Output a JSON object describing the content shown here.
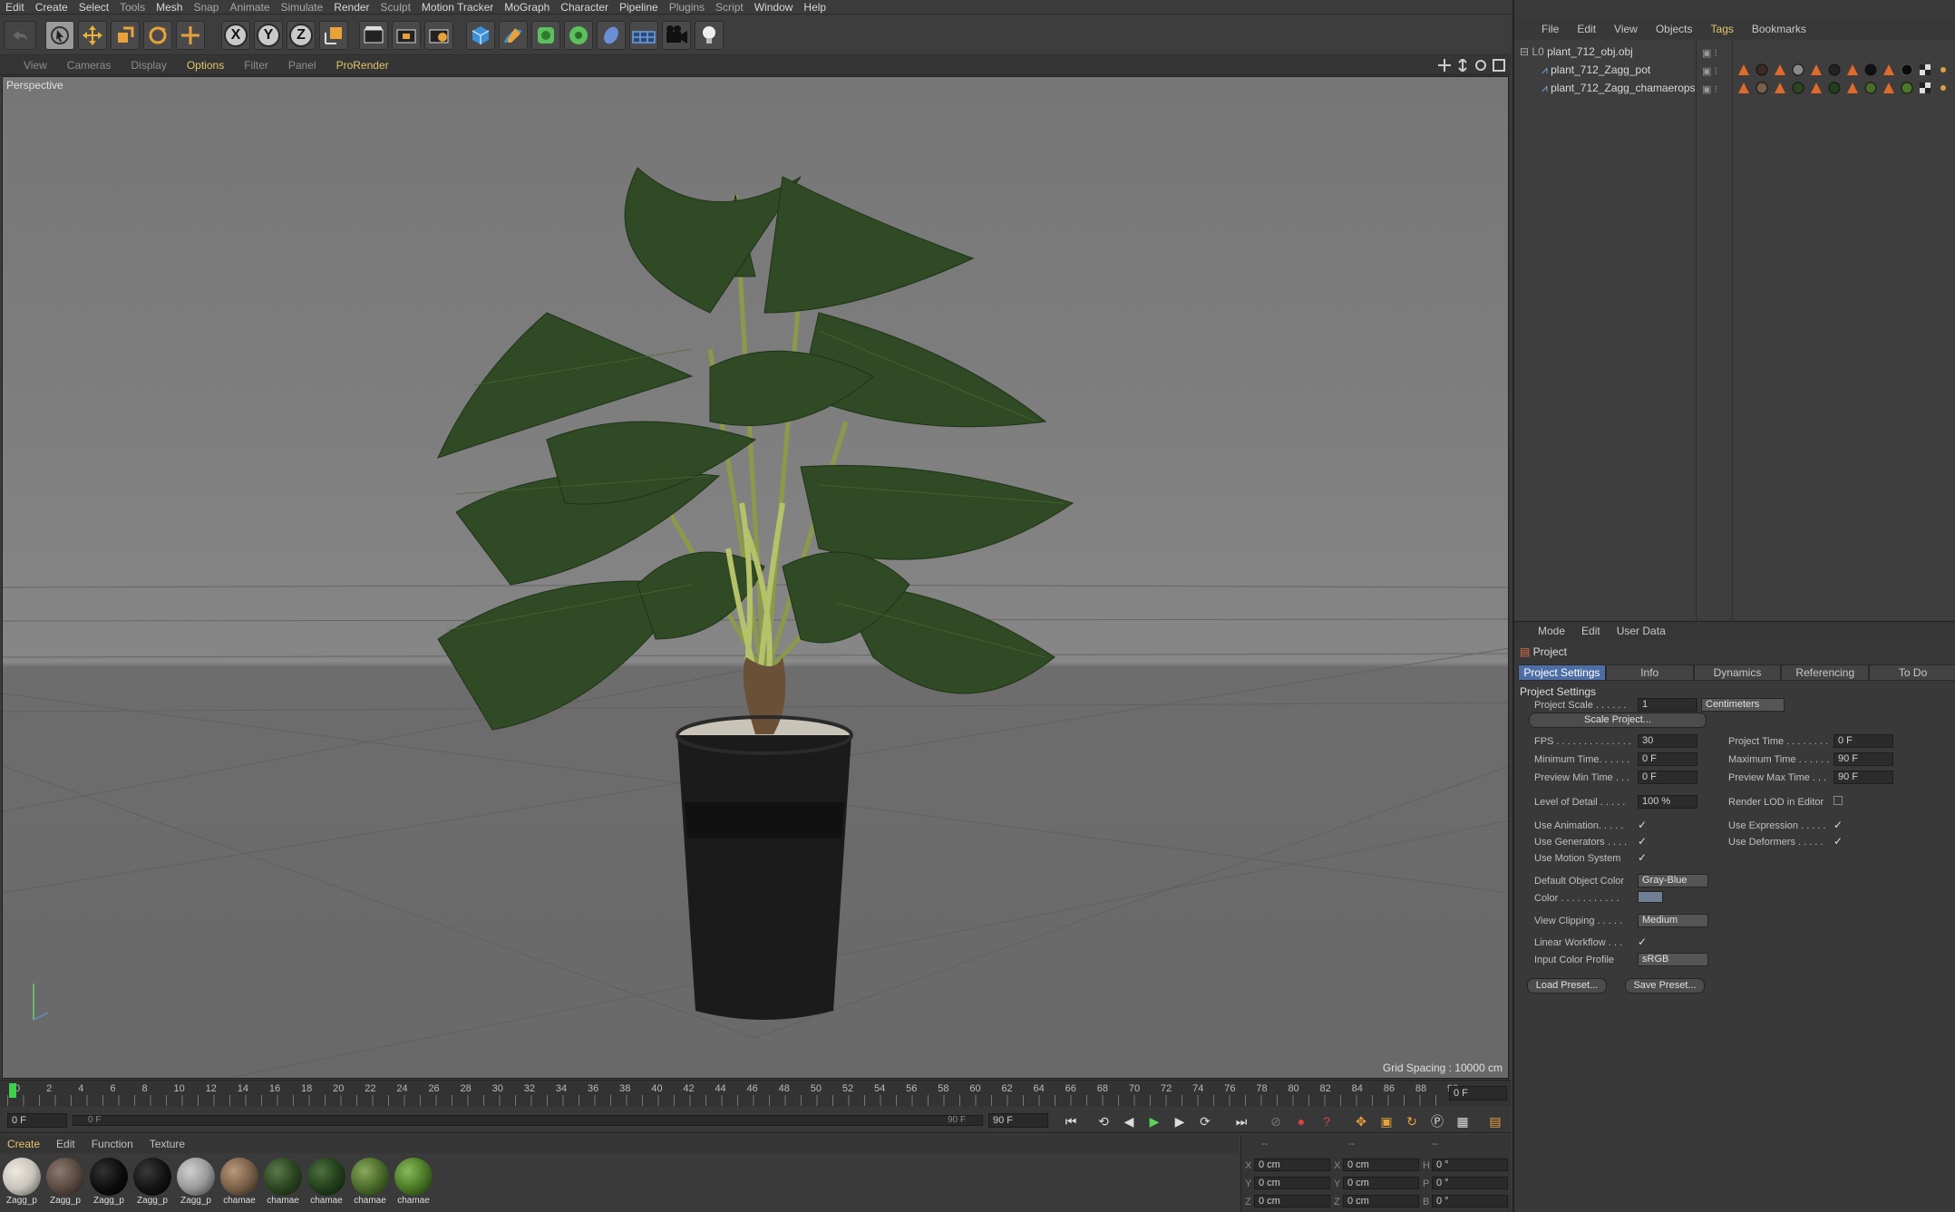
{
  "menu": [
    "Edit",
    "Create",
    "Select",
    "Tools",
    "Mesh",
    "Snap",
    "Animate",
    "Simulate",
    "Render",
    "Sculpt",
    "Motion Tracker",
    "MoGraph",
    "Character",
    "Pipeline",
    "Plugins",
    "Script",
    "Window",
    "Help"
  ],
  "toolbar": {
    "x_label": "X",
    "y_label": "Y",
    "z_label": "Z"
  },
  "viewmenu": [
    "View",
    "Cameras",
    "Display",
    "Options",
    "Filter",
    "Panel",
    "ProRender"
  ],
  "viewport": {
    "label": "Perspective",
    "grid_spacing": "Grid Spacing : 10000 cm"
  },
  "timeline": {
    "ticks": [
      "0",
      "2",
      "4",
      "6",
      "8",
      "10",
      "12",
      "14",
      "16",
      "18",
      "20",
      "22",
      "24",
      "26",
      "28",
      "30",
      "32",
      "34",
      "36",
      "38",
      "40",
      "42",
      "44",
      "46",
      "48",
      "50",
      "52",
      "54",
      "56",
      "58",
      "60",
      "62",
      "64",
      "66",
      "68",
      "70",
      "72",
      "74",
      "76",
      "78",
      "80",
      "82",
      "84",
      "86",
      "88",
      "90"
    ],
    "current_frame": "0 F",
    "start_field": "0 F",
    "range_start": "0 F",
    "range_end": "90 F",
    "end_field": "90 F"
  },
  "material_menu": [
    "Create",
    "Edit",
    "Function",
    "Texture"
  ],
  "materials": [
    {
      "label": "Zagg_p",
      "color": "#c8c4bc"
    },
    {
      "label": "Zagg_p",
      "color": "#5a4a40"
    },
    {
      "label": "Zagg_p",
      "color": "#0b0b0b"
    },
    {
      "label": "Zagg_p",
      "color": "#111111"
    },
    {
      "label": "Zagg_p",
      "color": "#9a9a9a"
    },
    {
      "label": "chamae",
      "color": "#7a6048"
    },
    {
      "label": "chamae",
      "color": "#2b4522"
    },
    {
      "label": "chamae",
      "color": "#23401c"
    },
    {
      "label": "chamae",
      "color": "#4a6a2a"
    },
    {
      "label": "chamae",
      "color": "#4a7a26"
    }
  ],
  "coordinates": {
    "header": [
      "--",
      "--",
      "--"
    ],
    "rows": [
      {
        "a": "X",
        "av": "0 cm",
        "b": "X",
        "bv": "0 cm",
        "c": "H",
        "cv": "0 °"
      },
      {
        "a": "Y",
        "av": "0 cm",
        "b": "Y",
        "bv": "0 cm",
        "c": "P",
        "cv": "0 °"
      },
      {
        "a": "Z",
        "av": "0 cm",
        "b": "Z",
        "bv": "0 cm",
        "c": "B",
        "cv": "0 °"
      }
    ]
  },
  "object_manager": {
    "menu": [
      "File",
      "Edit",
      "View",
      "Objects",
      "Tags",
      "Bookmarks"
    ],
    "objects": [
      {
        "name": "plant_712_obj.obj"
      },
      {
        "name": "plant_712_Zagg_pot"
      },
      {
        "name": "plant_712_Zagg_chamaerops"
      }
    ]
  },
  "attribute_manager": {
    "menu": [
      "Mode",
      "Edit",
      "User Data"
    ],
    "title": "Project",
    "tabs": [
      "Project Settings",
      "Info",
      "Dynamics",
      "Referencing",
      "To Do"
    ],
    "section": "Project Settings",
    "project_scale_label": "Project Scale . . . . . .",
    "project_scale_value": "1",
    "project_scale_unit": "Centimeters",
    "scale_project_btn": "Scale Project...",
    "fps_label": "FPS . . . . . . . . . . . . . .",
    "fps_value": "30",
    "project_time_label": "Project Time . . . . . . . .",
    "project_time_value": "0 F",
    "min_time_label": "Minimum Time. . . . . .",
    "min_time_value": "0 F",
    "max_time_label": "Maximum Time . . . . . .",
    "max_time_value": "90 F",
    "prev_min_label": "Preview Min Time . . .",
    "prev_min_value": "0 F",
    "prev_max_label": "Preview Max Time . . .",
    "prev_max_value": "90 F",
    "lod_label": "Level of Detail . . . . .",
    "lod_value": "100 %",
    "render_lod_label": "Render LOD in Editor",
    "use_animation": "Use Animation. . . . .",
    "use_expression": "Use Expression . . . . .",
    "use_generators": "Use Generators . . . .",
    "use_deformers": "Use Deformers . . . . .",
    "use_motion": "Use Motion System",
    "default_color_label": "Default Object Color",
    "default_color_value": "Gray-Blue",
    "color_label": "Color . . . . . . . . . . .",
    "view_clipping_label": "View Clipping . . . . .",
    "view_clipping_value": "Medium",
    "linear_workflow_label": "Linear Workflow . . .",
    "input_color_label": "Input Color Profile",
    "input_color_value": "sRGB",
    "load_preset": "Load Preset...",
    "save_preset": "Save Preset..."
  },
  "colors": {
    "accent": "#e3c46b",
    "tab_active": "#4d6ea5",
    "foliage": "#2f4a24",
    "pot": "#1a1a1a"
  }
}
